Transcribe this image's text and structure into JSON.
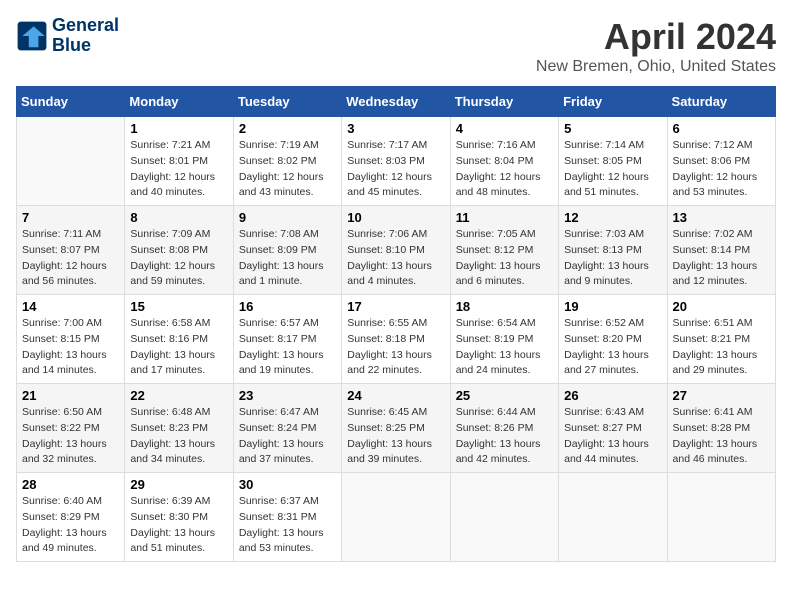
{
  "logo": {
    "line1": "General",
    "line2": "Blue"
  },
  "title": "April 2024",
  "subtitle": "New Bremen, Ohio, United States",
  "days_of_week": [
    "Sunday",
    "Monday",
    "Tuesday",
    "Wednesday",
    "Thursday",
    "Friday",
    "Saturday"
  ],
  "weeks": [
    [
      {
        "day": "",
        "info": ""
      },
      {
        "day": "1",
        "info": "Sunrise: 7:21 AM\nSunset: 8:01 PM\nDaylight: 12 hours\nand 40 minutes."
      },
      {
        "day": "2",
        "info": "Sunrise: 7:19 AM\nSunset: 8:02 PM\nDaylight: 12 hours\nand 43 minutes."
      },
      {
        "day": "3",
        "info": "Sunrise: 7:17 AM\nSunset: 8:03 PM\nDaylight: 12 hours\nand 45 minutes."
      },
      {
        "day": "4",
        "info": "Sunrise: 7:16 AM\nSunset: 8:04 PM\nDaylight: 12 hours\nand 48 minutes."
      },
      {
        "day": "5",
        "info": "Sunrise: 7:14 AM\nSunset: 8:05 PM\nDaylight: 12 hours\nand 51 minutes."
      },
      {
        "day": "6",
        "info": "Sunrise: 7:12 AM\nSunset: 8:06 PM\nDaylight: 12 hours\nand 53 minutes."
      }
    ],
    [
      {
        "day": "7",
        "info": "Sunrise: 7:11 AM\nSunset: 8:07 PM\nDaylight: 12 hours\nand 56 minutes."
      },
      {
        "day": "8",
        "info": "Sunrise: 7:09 AM\nSunset: 8:08 PM\nDaylight: 12 hours\nand 59 minutes."
      },
      {
        "day": "9",
        "info": "Sunrise: 7:08 AM\nSunset: 8:09 PM\nDaylight: 13 hours\nand 1 minute."
      },
      {
        "day": "10",
        "info": "Sunrise: 7:06 AM\nSunset: 8:10 PM\nDaylight: 13 hours\nand 4 minutes."
      },
      {
        "day": "11",
        "info": "Sunrise: 7:05 AM\nSunset: 8:12 PM\nDaylight: 13 hours\nand 6 minutes."
      },
      {
        "day": "12",
        "info": "Sunrise: 7:03 AM\nSunset: 8:13 PM\nDaylight: 13 hours\nand 9 minutes."
      },
      {
        "day": "13",
        "info": "Sunrise: 7:02 AM\nSunset: 8:14 PM\nDaylight: 13 hours\nand 12 minutes."
      }
    ],
    [
      {
        "day": "14",
        "info": "Sunrise: 7:00 AM\nSunset: 8:15 PM\nDaylight: 13 hours\nand 14 minutes."
      },
      {
        "day": "15",
        "info": "Sunrise: 6:58 AM\nSunset: 8:16 PM\nDaylight: 13 hours\nand 17 minutes."
      },
      {
        "day": "16",
        "info": "Sunrise: 6:57 AM\nSunset: 8:17 PM\nDaylight: 13 hours\nand 19 minutes."
      },
      {
        "day": "17",
        "info": "Sunrise: 6:55 AM\nSunset: 8:18 PM\nDaylight: 13 hours\nand 22 minutes."
      },
      {
        "day": "18",
        "info": "Sunrise: 6:54 AM\nSunset: 8:19 PM\nDaylight: 13 hours\nand 24 minutes."
      },
      {
        "day": "19",
        "info": "Sunrise: 6:52 AM\nSunset: 8:20 PM\nDaylight: 13 hours\nand 27 minutes."
      },
      {
        "day": "20",
        "info": "Sunrise: 6:51 AM\nSunset: 8:21 PM\nDaylight: 13 hours\nand 29 minutes."
      }
    ],
    [
      {
        "day": "21",
        "info": "Sunrise: 6:50 AM\nSunset: 8:22 PM\nDaylight: 13 hours\nand 32 minutes."
      },
      {
        "day": "22",
        "info": "Sunrise: 6:48 AM\nSunset: 8:23 PM\nDaylight: 13 hours\nand 34 minutes."
      },
      {
        "day": "23",
        "info": "Sunrise: 6:47 AM\nSunset: 8:24 PM\nDaylight: 13 hours\nand 37 minutes."
      },
      {
        "day": "24",
        "info": "Sunrise: 6:45 AM\nSunset: 8:25 PM\nDaylight: 13 hours\nand 39 minutes."
      },
      {
        "day": "25",
        "info": "Sunrise: 6:44 AM\nSunset: 8:26 PM\nDaylight: 13 hours\nand 42 minutes."
      },
      {
        "day": "26",
        "info": "Sunrise: 6:43 AM\nSunset: 8:27 PM\nDaylight: 13 hours\nand 44 minutes."
      },
      {
        "day": "27",
        "info": "Sunrise: 6:41 AM\nSunset: 8:28 PM\nDaylight: 13 hours\nand 46 minutes."
      }
    ],
    [
      {
        "day": "28",
        "info": "Sunrise: 6:40 AM\nSunset: 8:29 PM\nDaylight: 13 hours\nand 49 minutes."
      },
      {
        "day": "29",
        "info": "Sunrise: 6:39 AM\nSunset: 8:30 PM\nDaylight: 13 hours\nand 51 minutes."
      },
      {
        "day": "30",
        "info": "Sunrise: 6:37 AM\nSunset: 8:31 PM\nDaylight: 13 hours\nand 53 minutes."
      },
      {
        "day": "",
        "info": ""
      },
      {
        "day": "",
        "info": ""
      },
      {
        "day": "",
        "info": ""
      },
      {
        "day": "",
        "info": ""
      }
    ]
  ]
}
